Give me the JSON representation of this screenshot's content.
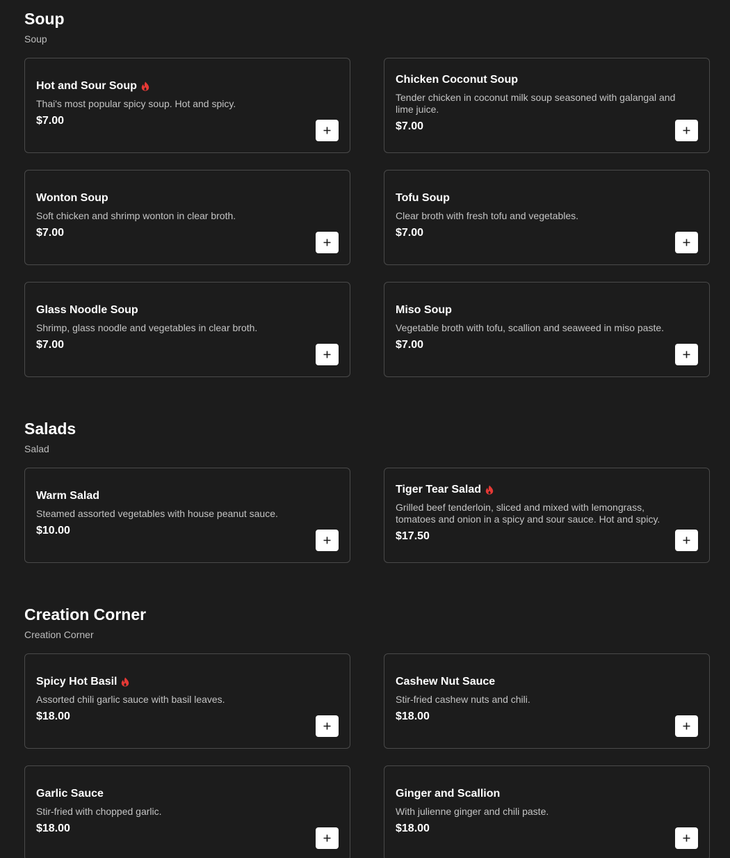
{
  "sections": [
    {
      "title": "Soup",
      "subtitle": "Soup",
      "items": [
        {
          "name": "Hot and Sour Soup",
          "description": "Thai's most popular spicy soup. Hot and spicy.",
          "price": "$7.00",
          "spicy": true
        },
        {
          "name": "Chicken Coconut Soup",
          "description": "Tender chicken in coconut milk soup seasoned with galangal and lime juice.",
          "price": "$7.00",
          "spicy": false
        },
        {
          "name": "Wonton Soup",
          "description": "Soft chicken and shrimp wonton in clear broth.",
          "price": "$7.00",
          "spicy": false
        },
        {
          "name": "Tofu Soup",
          "description": "Clear broth with fresh tofu and vegetables.",
          "price": "$7.00",
          "spicy": false
        },
        {
          "name": "Glass Noodle Soup",
          "description": "Shrimp, glass noodle and vegetables in clear broth.",
          "price": "$7.00",
          "spicy": false
        },
        {
          "name": "Miso Soup",
          "description": "Vegetable broth with tofu, scallion and seaweed in miso paste.",
          "price": "$7.00",
          "spicy": false
        }
      ]
    },
    {
      "title": "Salads",
      "subtitle": "Salad",
      "items": [
        {
          "name": "Warm Salad",
          "description": "Steamed assorted vegetables with house peanut sauce.",
          "price": "$10.00",
          "spicy": false
        },
        {
          "name": "Tiger Tear Salad",
          "description": "Grilled beef tenderloin, sliced and mixed with lemongrass, tomatoes and onion in a spicy and sour sauce. Hot and spicy.",
          "price": "$17.50",
          "spicy": true
        }
      ]
    },
    {
      "title": "Creation Corner",
      "subtitle": "Creation Corner",
      "items": [
        {
          "name": "Spicy Hot Basil",
          "description": "Assorted chili garlic sauce with basil leaves.",
          "price": "$18.00",
          "spicy": true
        },
        {
          "name": "Cashew Nut Sauce",
          "description": "Stir-fried cashew nuts and chili.",
          "price": "$18.00",
          "spicy": false
        },
        {
          "name": "Garlic Sauce",
          "description": "Stir-fried with chopped garlic.",
          "price": "$18.00",
          "spicy": false
        },
        {
          "name": "Ginger and Scallion",
          "description": "With julienne ginger and chili paste.",
          "price": "$18.00",
          "spicy": false
        }
      ]
    }
  ],
  "icons": {
    "spicy": "chili-pepper-icon",
    "add": "plus-icon"
  },
  "colors": {
    "background": "#1c1c1c",
    "card_border": "#4a4a4a",
    "spicy": "#e53935",
    "button_bg": "#ffffff"
  }
}
